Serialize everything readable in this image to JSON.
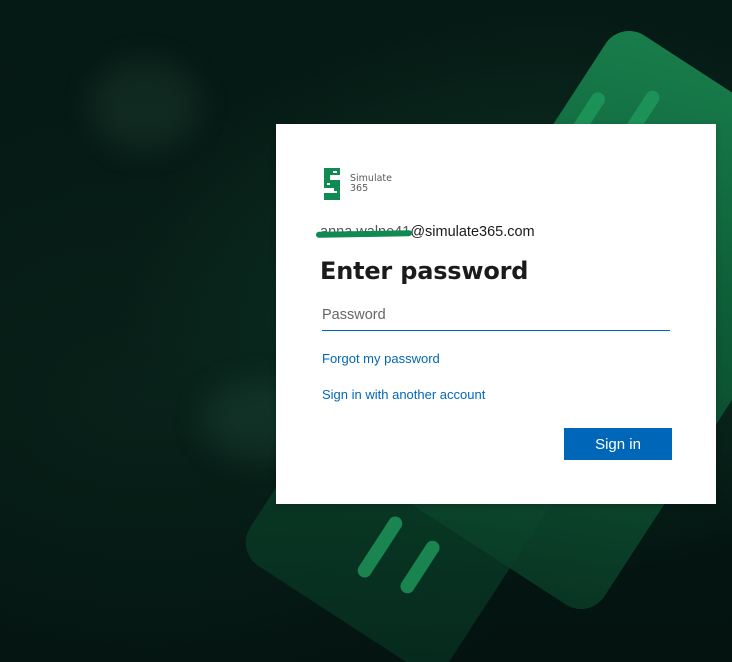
{
  "brand": {
    "logo_line1": "Simulate",
    "logo_line2": "365",
    "accent": "#0f8a52",
    "logo_icon": "simulate365-logo-icon"
  },
  "signin": {
    "account_user": "anna.walne41",
    "account_domain": "@simulate365.com",
    "title": "Enter password",
    "password_placeholder": "Password",
    "password_value": "",
    "forgot_link": "Forgot my password",
    "other_account_link": "Sign in with another account",
    "submit_label": "Sign in",
    "primary_color": "#0067b8"
  }
}
